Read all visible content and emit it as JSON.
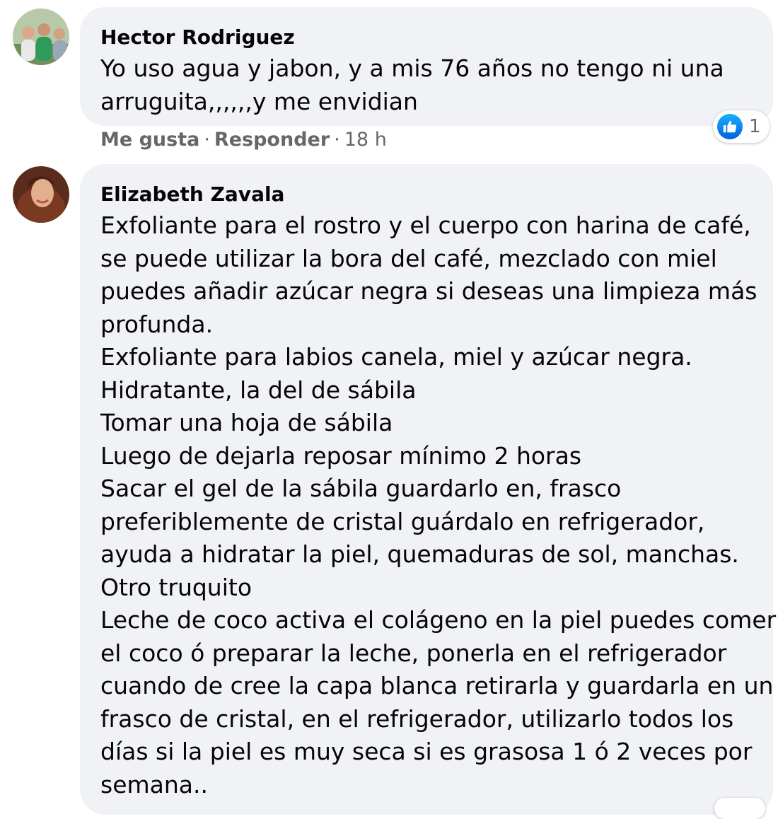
{
  "comments": [
    {
      "author": "Hector Rodriguez",
      "lines": [
        "Yo uso agua y jabon, y a mis 76 años no tengo ni una",
        "arruguita,,,,,,y me envidian"
      ],
      "actions": {
        "like_label": "Me gusta",
        "reply_label": "Responder",
        "separator": "·",
        "timestamp": "18 h"
      },
      "reactions": {
        "icon": "like-icon",
        "count": "1",
        "color": "#1877f2"
      }
    },
    {
      "author": "Elizabeth Zavala",
      "lines": [
        "Exfoliante para el rostro y el cuerpo con harina de café,",
        "se puede utilizar la bora del café, mezclado con miel",
        "puedes añadir azúcar negra si deseas una limpieza más",
        "profunda.",
        "Exfoliante para labios canela, miel y azúcar negra.",
        "Hidratante, la del de sábila",
        "Tomar una hoja de sábila",
        "Luego de dejarla reposar mínimo 2 horas",
        "Sacar el gel de la sábila guardarlo en, frasco",
        "preferiblemente de cristal guárdalo en refrigerador,",
        "ayuda a hidratar la piel, quemaduras de sol, manchas.",
        "Otro truquito",
        "Leche de coco activa el colágeno en la piel puedes comer",
        "el coco ó preparar la leche, ponerla en el refrigerador",
        "cuando de cree la capa blanca retirarla y guardarla en un",
        "frasco de cristal, en el refrigerador, utilizarlo todos los",
        "días si la piel es muy seca si es grasosa 1 ó 2 veces por",
        "semana.."
      ]
    }
  ],
  "theme": {
    "bubble_bg": "#f0f2f5",
    "text": "#050505",
    "meta_text": "#65676b",
    "like_blue": "#1877f2"
  }
}
